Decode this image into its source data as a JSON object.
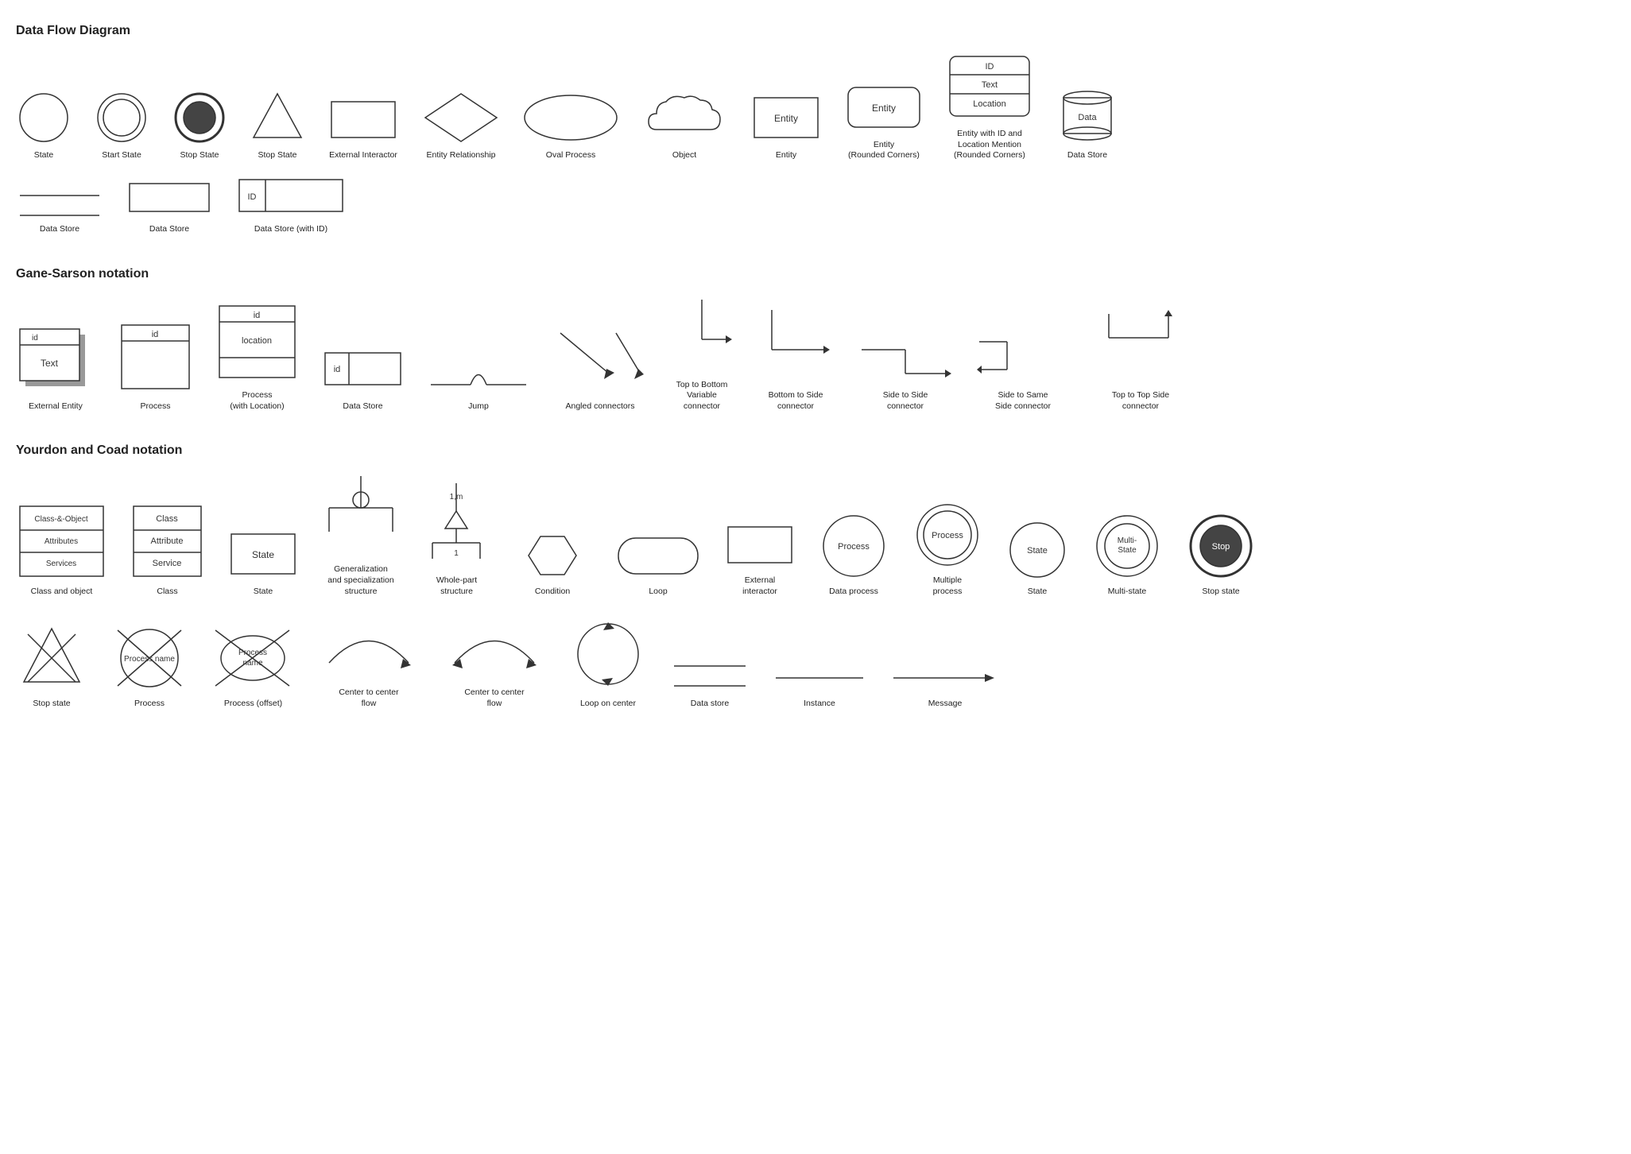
{
  "sections": {
    "dfd": {
      "title": "Data Flow Diagram",
      "items_row1": [
        {
          "name": "State",
          "label": "State"
        },
        {
          "name": "Start State",
          "label": "Start State"
        },
        {
          "name": "Stop State",
          "label": "Stop State"
        },
        {
          "name": "Stop State 2",
          "label": "Stop State"
        },
        {
          "name": "External Interactor",
          "label": "External Interactor"
        },
        {
          "name": "Entity Relationship",
          "label": "Entity Relationship"
        },
        {
          "name": "Oval Process",
          "label": "Oval Process"
        },
        {
          "name": "Object",
          "label": "Object"
        },
        {
          "name": "Entity",
          "label": "Entity"
        },
        {
          "name": "Entity Rounded",
          "label": "Entity\n(Rounded Corners)"
        },
        {
          "name": "Entity with ID",
          "label": "Entity with ID and\nLocation Mention\n(Rounded Corners)"
        },
        {
          "name": "Data Store Cylinder",
          "label": "Data Store"
        }
      ],
      "items_row2": [
        {
          "name": "Data Store Line",
          "label": "Data Store"
        },
        {
          "name": "Data Store Box",
          "label": "Data Store"
        },
        {
          "name": "Data Store ID",
          "label": "Data Store (with ID)"
        }
      ]
    },
    "gane_sarson": {
      "title": "Gane-Sarson notation",
      "items": [
        {
          "name": "External Entity",
          "label": "External Entity"
        },
        {
          "name": "Process",
          "label": "Process"
        },
        {
          "name": "Process with Location",
          "label": "Process\n(with Location)"
        },
        {
          "name": "Data Store GS",
          "label": "Data Store"
        },
        {
          "name": "Jump",
          "label": "Jump"
        },
        {
          "name": "Angled connectors",
          "label": "Angled connectors"
        },
        {
          "name": "Top to Bottom",
          "label": "Top to Bottom\nVariable\nconnector"
        },
        {
          "name": "Bottom to Side",
          "label": "Bottom to Side\nconnector"
        },
        {
          "name": "Side to Side",
          "label": "Side to Side\nconnector"
        },
        {
          "name": "Side to Same Side",
          "label": "Side to Same\nSide connector"
        },
        {
          "name": "Top to Top Side",
          "label": "Top to Top Side\nconnector"
        }
      ]
    },
    "yourdon": {
      "title": "Yourdon and Coad notation",
      "items_row1": [
        {
          "name": "Class and object",
          "label": "Class and object"
        },
        {
          "name": "Class YC",
          "label": "Class"
        },
        {
          "name": "State YC",
          "label": "State"
        },
        {
          "name": "Generalization",
          "label": "Generalization\nand specialization\nstructure"
        },
        {
          "name": "Whole-part",
          "label": "Whole-part\nstructure"
        },
        {
          "name": "Condition",
          "label": "Condition"
        },
        {
          "name": "Loop YC",
          "label": "Loop"
        },
        {
          "name": "External interactor",
          "label": "External\ninteractor"
        },
        {
          "name": "Data process",
          "label": "Data process"
        },
        {
          "name": "Multiple process",
          "label": "Multiple\nprocess"
        },
        {
          "name": "State circle",
          "label": "State"
        },
        {
          "name": "Multi-state",
          "label": "Multi-state"
        },
        {
          "name": "Stop state YC",
          "label": "Stop state"
        }
      ],
      "items_row2": [
        {
          "name": "Stop state triangle",
          "label": "Stop state"
        },
        {
          "name": "Process offset",
          "label": "Process"
        },
        {
          "name": "Process offset2",
          "label": "Process (offset)"
        },
        {
          "name": "Center to center 1",
          "label": "Center to center\nflow"
        },
        {
          "name": "Center to center 2",
          "label": "Center to center\nflow"
        },
        {
          "name": "Loop on center",
          "label": "Loop on center"
        },
        {
          "name": "Data store YC",
          "label": "Data store"
        },
        {
          "name": "Instance YC",
          "label": "Instance"
        },
        {
          "name": "Message YC",
          "label": "Message"
        }
      ]
    }
  }
}
